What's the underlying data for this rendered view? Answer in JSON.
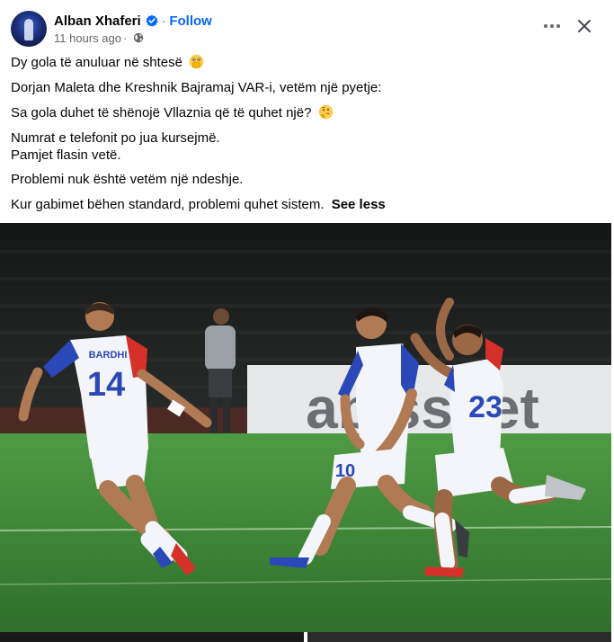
{
  "post": {
    "author": "Alban Xhaferi",
    "follow_label": "Follow",
    "separator": "·",
    "timestamp": "11 hours ago",
    "meta_separator": "·",
    "visibility_icon": "globe-icon",
    "verified_icon": "verified-badge-icon",
    "more_icon": "more-options-icon",
    "close_icon": "close-icon",
    "lines": [
      "Dy gola të anuluar në shtesë",
      "Dorjan Maleta dhe Kreshnik Bajramaj VAR-i, vetëm një pyetje:",
      "Sa gola duhet të shënojë Vllaznia që të quhet një?",
      "Numrat e telefonit po jua kursejmë.",
      "Pamjet flasin vetë.",
      "Problemi nuk është vetëm një ndeshje.",
      "Kur gabimet bëhen standard, problemi quhet sistem."
    ],
    "emoji_1": "face-with-open-eyes-and-hand-over-mouth",
    "emoji_2": "thinking-face",
    "see_less_label": "See less"
  },
  "photo": {
    "billboard_text": "abissnet",
    "players": [
      {
        "name": "BARDHI",
        "number": "14"
      },
      {
        "name": "",
        "number": "10"
      },
      {
        "name": "",
        "number": "23"
      }
    ]
  },
  "colors": {
    "accent": "#0866ff",
    "text": "#050505",
    "secondary": "#65676b",
    "pitch": "#3f8a3a",
    "kit_red": "#d6302a",
    "kit_blue": "#2b48b8"
  }
}
